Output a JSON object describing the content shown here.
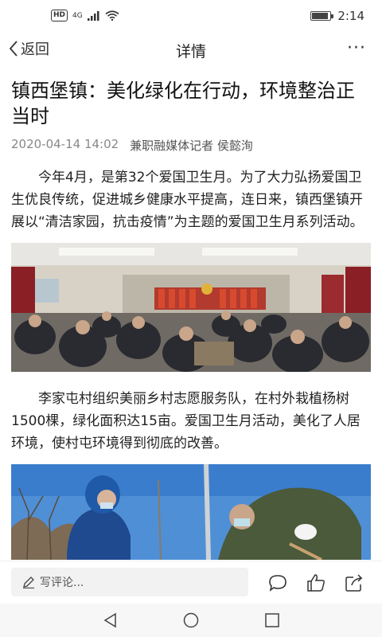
{
  "status_bar": {
    "hd_badge": "HD",
    "network": "4G",
    "time": "2:14",
    "battery_level": 0.9
  },
  "nav": {
    "back_label": "返回",
    "title": "详情",
    "more_label": "···"
  },
  "article": {
    "headline": "镇西堡镇：美化绿化在行动，环境整治正当时",
    "date": "2020-04-14 14:02",
    "author": "兼职融媒体记者 侯懿洵",
    "paragraph1": "今年4月，是第32个爱国卫生月。为了大力弘扬爱国卫生优良传统，促进城乡健康水平提高，连日来，镇西堡镇开展以“清洁家园，抗击疫情”为主题的爱国卫生月系列活动。",
    "paragraph2": "李家屯村组织美丽乡村志愿服务队，在村外栽植杨树1500棵，绿化面积达15亩。爱国卫生月活动，美化了人居环境，使村屯环境得到彻底的改善。"
  },
  "bottom_bar": {
    "comment_placeholder": "写评论..."
  },
  "colors": {
    "background": "#ffffff",
    "text": "#222222",
    "meta": "#888888",
    "comment_box": "#f2f2f2"
  }
}
